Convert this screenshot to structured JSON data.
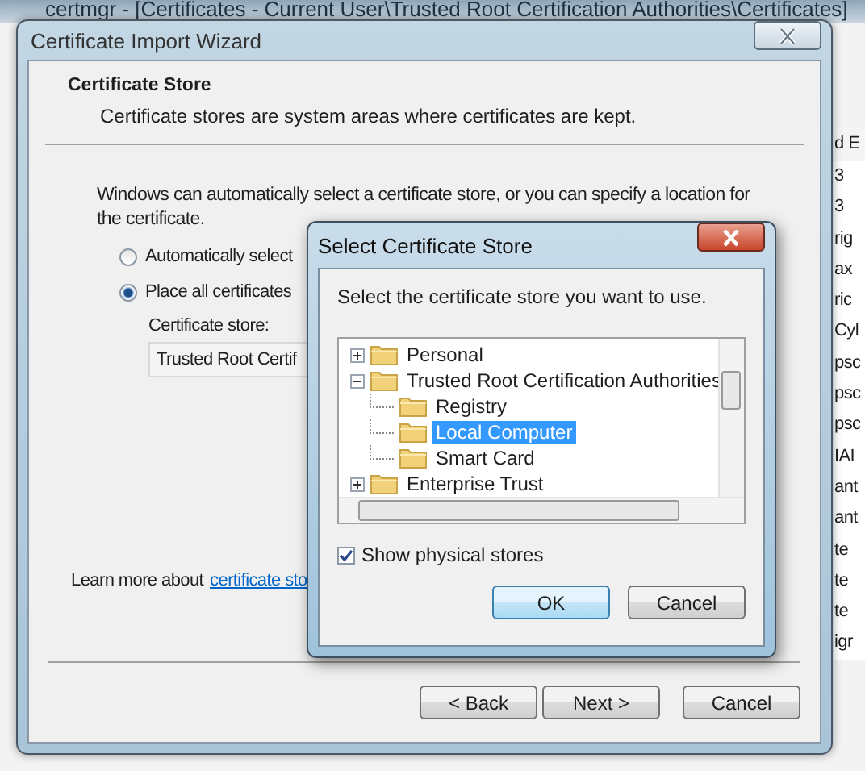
{
  "background_window": {
    "title": "certmgr - [Certificates - Current User\\Trusted Root Certification Authorities\\Certificates]",
    "column_header": "d E",
    "column_cells": [
      "3",
      "3",
      "rig",
      "ax",
      "ric",
      "Cyl",
      "psc",
      "psc",
      "psc",
      "IAI",
      "ant",
      "ant",
      "te",
      "te",
      "te",
      "igr"
    ]
  },
  "wizard": {
    "title": "Certificate Import Wizard",
    "header_title": "Certificate Store",
    "header_subtitle": "Certificate stores are system areas where certificates are kept.",
    "description": "Windows can automatically select a certificate store, or you can specify a location for the certificate.",
    "options": [
      {
        "label": "Automatically select",
        "selected": false
      },
      {
        "label": "Place all certificates",
        "selected": true
      }
    ],
    "store_label": "Certificate store:",
    "store_value": "Trusted Root Certif",
    "learn_more_text": "Learn more about",
    "learn_more_link": "certificate sto",
    "buttons": [
      "< Back",
      "Next >",
      "Cancel"
    ]
  },
  "dialog": {
    "title": "Select Certificate Store",
    "prompt": "Select the certificate store you want to use.",
    "tree": [
      {
        "label": "Personal",
        "expanded": false,
        "selected": false
      },
      {
        "label": "Trusted Root Certification Authorities",
        "expanded": true,
        "selected": false,
        "children": [
          {
            "label": "Registry",
            "selected": false
          },
          {
            "label": "Local Computer",
            "selected": true
          },
          {
            "label": "Smart Card",
            "selected": false
          }
        ]
      },
      {
        "label": "Enterprise Trust",
        "expanded": false,
        "selected": false
      }
    ],
    "show_physical": {
      "label": "Show physical stores",
      "checked": true
    },
    "buttons": [
      "OK",
      "Cancel"
    ]
  }
}
